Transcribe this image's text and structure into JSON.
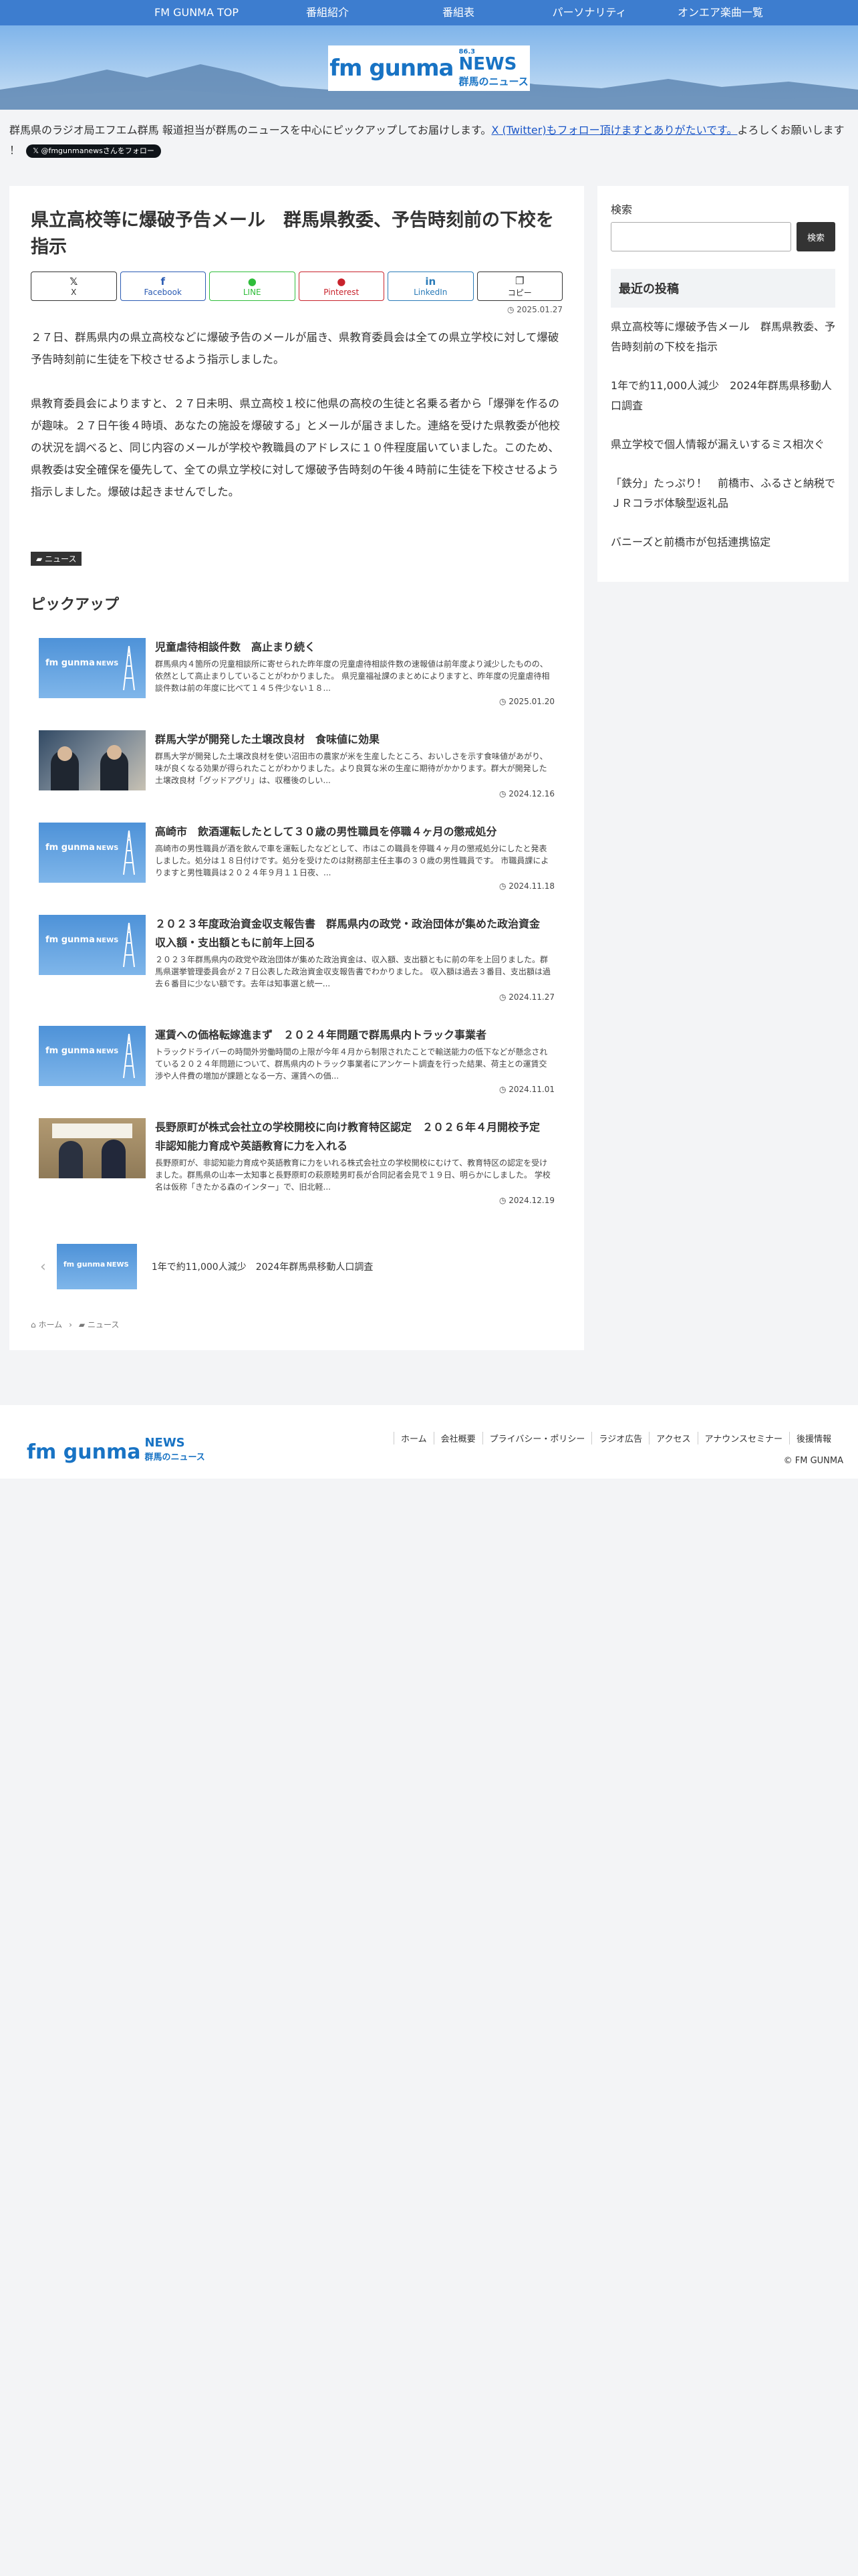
{
  "nav": {
    "items": [
      {
        "label": "FM GUNMA TOP"
      },
      {
        "label": "番組紹介"
      },
      {
        "label": "番組表"
      },
      {
        "label": "パーソナリティ"
      },
      {
        "label": "オンエア楽曲一覧"
      }
    ]
  },
  "logo": {
    "brand": "fm gunma",
    "frequency": "86.3",
    "news": "NEWS",
    "subtitle": "群馬のニュース"
  },
  "notice": {
    "text": "群馬県のラジオ局エフエム群馬 報道担当が群馬のニュースを中心にピックアップしてお届けします。",
    "link": "X (Twitter)もフォロー頂けますとありがたいです。",
    "tail": "よろしくお願いします ！",
    "follow_button": "@fmgunmanewsさんをフォロー"
  },
  "article": {
    "title": "県立高校等に爆破予告メール　群馬県教委、予告時刻前の下校を指示",
    "date": "2025.01.27",
    "paragraphs": [
      "２７日、群馬県内の県立高校などに爆破予告のメールが届き、県教育委員会は全ての県立学校に対して爆破予告時刻前に生徒を下校させるよう指示しました。",
      "県教育委員会によりますと、２７日未明、県立高校１校に他県の高校の生徒と名乗る者から「爆弾を作るのが趣味。２７日午後４時頃、あなたの施設を爆破する」とメールが届きました。連絡を受けた県教委が他校の状況を調べると、同じ内容のメールが学校や教職員のアドレスに１０件程度届いていました。このため、県教委は安全確保を優先して、全ての県立学校に対して爆破予告時刻の午後４時前に生徒を下校させるよう指示しました。爆破は起きませんでした。"
    ],
    "category": "ニュース"
  },
  "share": {
    "x": "X",
    "facebook": "Facebook",
    "line": "LINE",
    "pinterest": "Pinterest",
    "linkedin": "LinkedIn",
    "copy": "コピー"
  },
  "pickup": {
    "heading": "ピックアップ",
    "items": [
      {
        "title": "児童虐待相談件数　高止まり続く",
        "snippet": "群馬県内４箇所の児童相談所に寄せられた昨年度の児童虐待相談件数の速報値は前年度より減少したものの、依然として高止まりしていることがわかりました。 県児童福祉課のまとめによりますと、昨年度の児童虐待相談件数は前の年度に比べて１４５件少ない１８...",
        "date": "2025.01.20"
      },
      {
        "title": "群馬大学が開発した土壌改良材　食味値に効果",
        "snippet": "群馬大学が開発した土壌改良材を使い沼田市の農家が米を生産したところ、おいしさを示す食味値があがり、味が良くなる効果が得られたことがわかりました。より良質な米の生産に期待がかかります。群大が開発した土壌改良材「グッドアグリ」は、収穫後のしい...",
        "date": "2024.12.16"
      },
      {
        "title": "高崎市　飲酒運転したとして３０歳の男性職員を停職４ヶ月の懲戒処分",
        "snippet": "高崎市の男性職員が酒を飲んで車を運転したなどとして、市はこの職員を停職４ヶ月の懲戒処分にしたと発表しました。処分は１８日付けです。処分を受けたのは財務部主任主事の３０歳の男性職員です。 市職員課によりますと男性職員は２０２４年９月１１日夜、...",
        "date": "2024.11.18"
      },
      {
        "title": "２０２３年度政治資金収支報告書　群馬県内の政党・政治団体が集めた政治資金　収入額・支出額ともに前年上回る",
        "snippet": "２０２３年群馬県内の政党や政治団体が集めた政治資金は、収入額、支出額ともに前の年を上回りました。群馬県選挙管理委員会が２７日公表した政治資金収支報告書でわかりました。 収入額は過去３番目、支出額は過去６番目に少ない額です。去年は知事選と統一...",
        "date": "2024.11.27"
      },
      {
        "title": "運賃への価格転嫁進まず　２０２４年問題で群馬県内トラック事業者",
        "snippet": "トラックドライバーの時間外労働時間の上限が今年４月から制限されたことで輸送能力の低下などが懸念されている２０２４年問題について、群馬県内のトラック事業者にアンケート調査を行った結果、荷主との運賃交渉や人件費の増加が課題となる一方、運賃への価...",
        "date": "2024.11.01"
      },
      {
        "title": "長野原町が株式会社立の学校開校に向け教育特区認定　２０２６年４月開校予定　非認知能力育成や英語教育に力を入れる",
        "snippet": "長野原町が、非認知能力育成や英語教育に力をいれる株式会社立の学校開校にむけて、教育特区の認定を受けました。群馬県の山本一太知事と長野原町の萩原睦男町長が合同記者会見で１９日、明らかにしました。 学校名は仮称「きたかる森のインター」で、旧北軽...",
        "date": "2024.12.19"
      }
    ]
  },
  "carousel": {
    "label": "1年で約11,000人減少　2024年群馬県移動人口調査"
  },
  "breadcrumb": {
    "home": "ホーム",
    "category": "ニュース"
  },
  "sidebar": {
    "search_label": "検索",
    "search_placeholder": "",
    "search_button": "検索",
    "recent_heading": "最近の投稿",
    "recent": [
      {
        "label": "県立高校等に爆破予告メール　群馬県教委、予告時刻前の下校を指示"
      },
      {
        "label": "1年で約11,000人減少　2024年群馬県移動人口調査"
      },
      {
        "label": "県立学校で個人情報が漏えいするミス相次ぐ"
      },
      {
        "label": "「鉄分」たっぷり！　前橋市、ふるさと納税でＪＲコラボ体験型返礼品"
      },
      {
        "label": "バニーズと前橋市が包括連携協定"
      }
    ]
  },
  "footer": {
    "links": [
      {
        "label": "ホーム"
      },
      {
        "label": "会社概要"
      },
      {
        "label": "プライバシー・ポリシー"
      },
      {
        "label": "ラジオ広告"
      },
      {
        "label": "アクセス"
      },
      {
        "label": "アナウンスセミナー"
      },
      {
        "label": "後援情報"
      }
    ],
    "copyright": "© FM GUNMA"
  },
  "icons": {
    "clock": "clock-icon",
    "folder": "folder-icon",
    "home": "home-icon",
    "chevron": "chevron-right-icon"
  },
  "colors": {
    "nav_bg": "#3d7dcf",
    "brand_blue": "#1873c4",
    "link_blue": "#1a56c8"
  }
}
